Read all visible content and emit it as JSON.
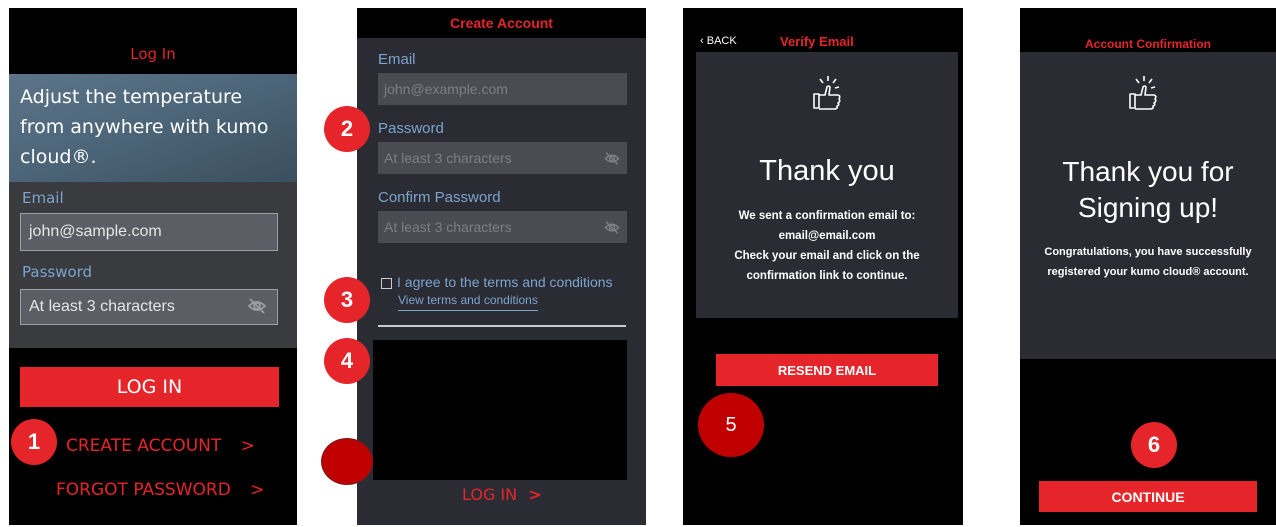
{
  "login": {
    "title": "Log In",
    "hero_text": "Adjust the temperature from anywhere with kumo cloud®.",
    "email_label": "Email",
    "email_value": "john@sample.com",
    "password_label": "Password",
    "password_placeholder": "At least 3 characters",
    "login_button": "LOG IN",
    "create_account": "CREATE ACCOUNT",
    "forgot_password": "FORGOT PASSWORD",
    "chevron": ">"
  },
  "create": {
    "title": "Create Account",
    "email_label": "Email",
    "email_placeholder": "john@example.com",
    "password_label": "Password",
    "password_placeholder": "At least 3 characters",
    "confirm_label": "Confirm Password",
    "confirm_placeholder": "At least 3 characters",
    "terms_text": "I agree to the terms and conditions",
    "terms_link": "View terms and conditions",
    "login_link": "LOG IN",
    "chevron": ">"
  },
  "verify": {
    "back": "BACK",
    "title": "Verify Email",
    "heading": "Thank you",
    "line1": "We sent a confirmation email to:",
    "line2": "email@email.com",
    "line3": "Check your email and click on the",
    "line4": "confirmation link to continue.",
    "resend_button": "RESEND EMAIL"
  },
  "confirm": {
    "title": "Account Confirmation",
    "heading_line1": "Thank you for",
    "heading_line2": "Signing up!",
    "line1": "Congratulations, you have successfully",
    "line2": "registered your kumo cloud® account.",
    "continue_button": "CONTINUE"
  },
  "badges": {
    "b1": "1",
    "b2": "2",
    "b3": "3",
    "b4": "4",
    "b5": "5",
    "b6": "6"
  },
  "colors": {
    "accent_red": "#e5252a",
    "label_blue": "#7ba3cf",
    "panel_dark": "#2b2c33"
  },
  "icons": [
    "eye-slash-icon",
    "thumbs-up-icon",
    "chevron-left-icon",
    "chevron-right-icon",
    "checkbox-icon"
  ]
}
